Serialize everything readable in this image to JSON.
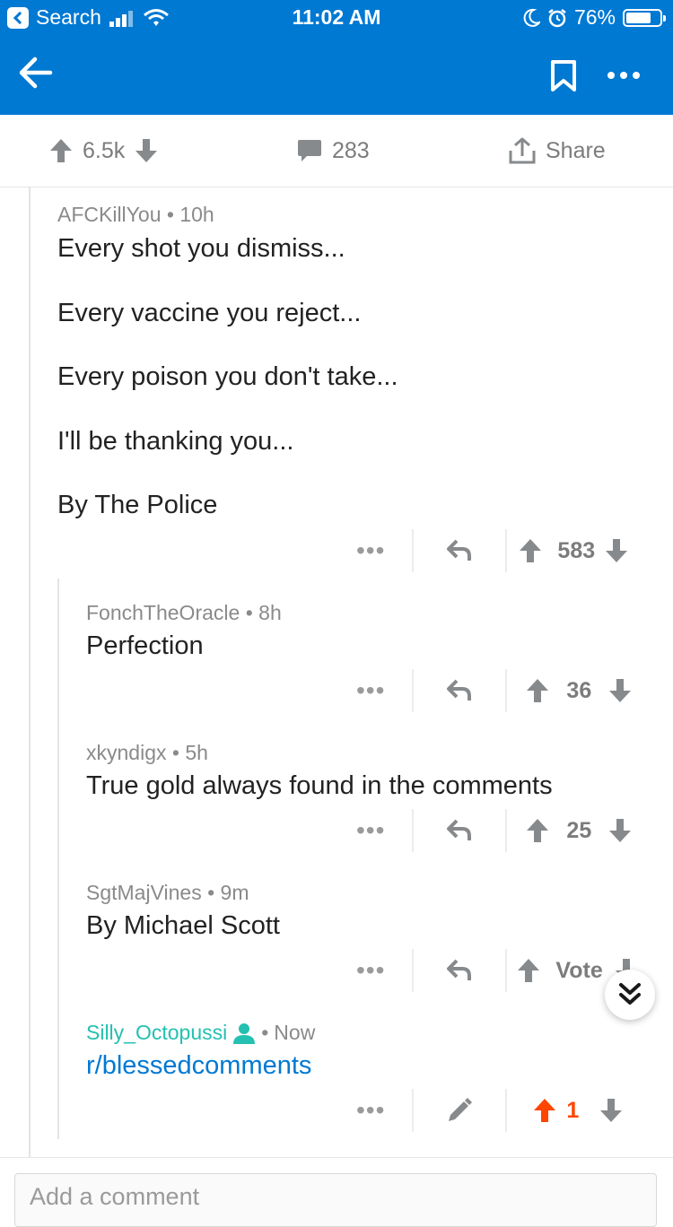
{
  "status_bar": {
    "carrier": "Search",
    "time": "11:02 AM",
    "battery": "76%",
    "battery_level": 0.76
  },
  "post_bar": {
    "upvotes": "6.5k",
    "comments": "283",
    "share": "Share"
  },
  "comments": [
    {
      "author": "AFCKillYou",
      "age": "10h",
      "lines": [
        "Every shot you dismiss...",
        "Every vaccine you reject...",
        "Every poison you don't take...",
        "I'll be thanking you...",
        "By The Police"
      ],
      "score": "583"
    },
    {
      "author": "FonchTheOracle",
      "age": "8h",
      "lines": [
        "Perfection"
      ],
      "score": "36"
    },
    {
      "author": "xkyndigx",
      "age": "5h",
      "lines": [
        "True gold always found in the comments"
      ],
      "score": "25"
    },
    {
      "author": "SgtMajVines",
      "age": "9m",
      "lines": [
        "By Michael Scott"
      ],
      "score": "Vote"
    },
    {
      "author": "Silly_Octopussi",
      "age": "Now",
      "lines": [
        "r/blessedcomments"
      ],
      "score": "1"
    }
  ],
  "add_comment_placeholder": "Add a comment",
  "colors": {
    "header": "#0079d3",
    "upvote_active": "#ff4500",
    "op_author": "#24c0b1",
    "link": "#0079d3"
  },
  "icons": [
    "back-arrow-icon",
    "bookmark-icon",
    "more-icon",
    "upvote-icon",
    "downvote-icon",
    "comment-icon",
    "share-icon",
    "reply-icon",
    "edit-icon",
    "user-icon",
    "scroll-down-icon"
  ]
}
